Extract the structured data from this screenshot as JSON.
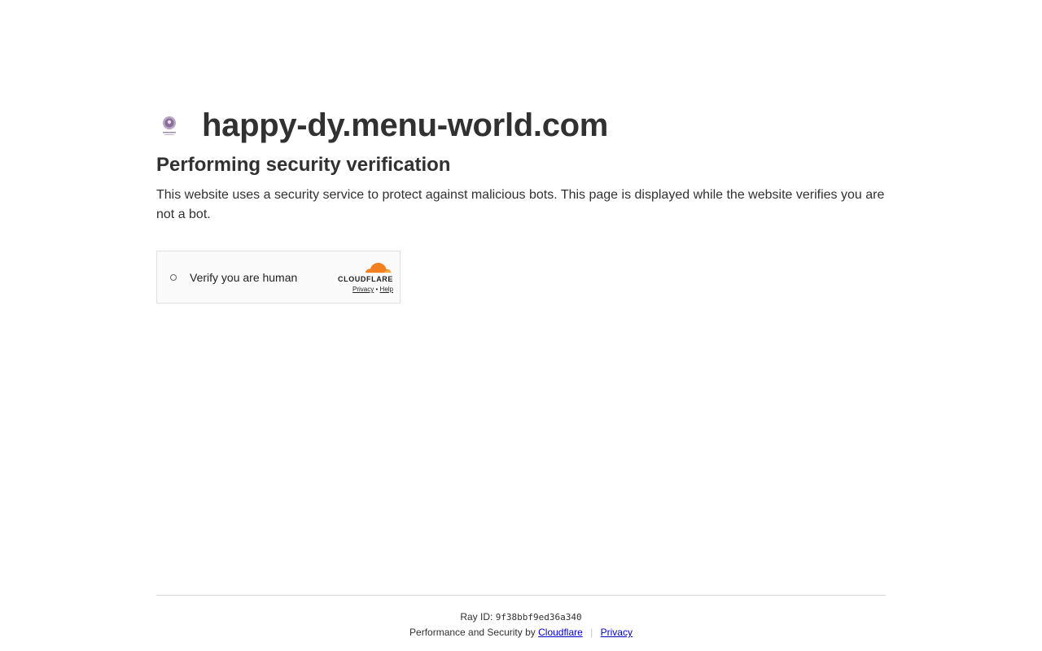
{
  "site": {
    "host": "happy-dy.menu-world.com",
    "logo_icon": "site-logo-icon"
  },
  "verification": {
    "heading": "Performing security verification",
    "description": "This website uses a security service to protect against malicious bots. This page is displayed while the website verifies you are not a bot."
  },
  "widget": {
    "label": "Verify you are human",
    "brand": "CLOUDFLARE",
    "privacy_link": "Privacy",
    "separator": "•",
    "help_link": "Help"
  },
  "footer": {
    "ray_label": "Ray ID:",
    "ray_id": "9f38bbf9ed36a340",
    "perf_text": "Performance and Security by",
    "cloudflare_link": "Cloudflare",
    "separator": "|",
    "privacy_link": "Privacy"
  },
  "colors": {
    "text": "#313131",
    "link": "#0000cc",
    "cloud_orange": "#f38020",
    "cloud_light": "#faae40"
  }
}
